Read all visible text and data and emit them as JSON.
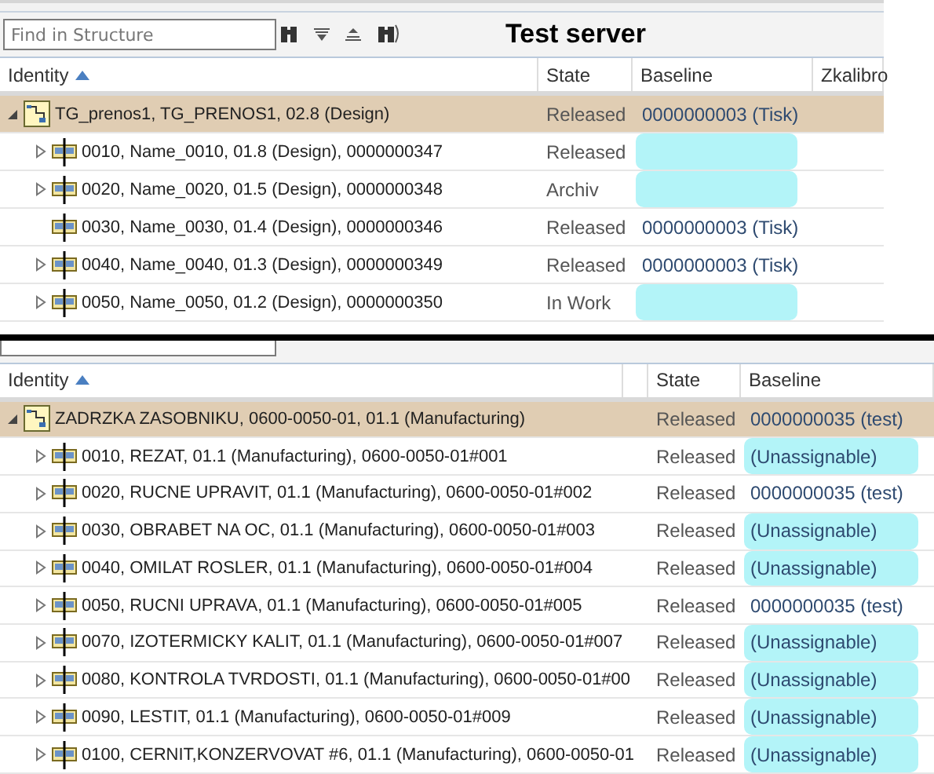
{
  "panels": [
    {
      "search": {
        "placeholder": "Find in Structure"
      },
      "title": "Test server",
      "columns": [
        {
          "label": "Identity",
          "sorted": true
        },
        {
          "label": "State"
        },
        {
          "label": "Baseline"
        },
        {
          "label": "Zkalibro"
        }
      ],
      "tree": {
        "identity": "TG_prenos1, TG_PRENOS1, 02.8 (Design)",
        "state": "Released",
        "baseline": "0000000003 (Tisk)",
        "highlighted": false,
        "expanded": true,
        "children": [
          {
            "identity": "0010, Name_0010, 01.8 (Design), 0000000347",
            "state": "Released",
            "highlighted": true,
            "expandable": true
          },
          {
            "identity": "0020, Name_0020, 01.5 (Design), 0000000348",
            "state": "Archiv",
            "highlighted": true,
            "expandable": true
          },
          {
            "identity": "0030, Name_0030, 01.4 (Design), 0000000346",
            "state": "Released",
            "baseline": "0000000003 (Tisk)",
            "highlighted": false,
            "expandable": false
          },
          {
            "identity": "0040, Name_0040, 01.3 (Design), 0000000349",
            "state": "Released",
            "baseline": "0000000003 (Tisk)",
            "highlighted": false,
            "expandable": true
          },
          {
            "identity": "0050, Name_0050, 01.2 (Design), 0000000350",
            "state": "In Work",
            "highlighted": true,
            "expandable": true
          }
        ]
      }
    },
    {
      "columns": [
        {
          "label": "Identity",
          "sorted": true
        },
        {
          "label": "State"
        },
        {
          "label": "Baseline"
        }
      ],
      "tree": {
        "identity": "ZADRZKA ZASOBNIKU, 0600-0050-01, 01.1 (Manufacturing)",
        "state": "Released",
        "baseline": "0000000035 (test)",
        "highlighted": false,
        "expanded": true,
        "children": [
          {
            "identity": "0010, REZAT, 01.1 (Manufacturing), 0600-0050-01#001",
            "state": "Released",
            "baseline": "(Unassignable)",
            "highlighted": true,
            "expandable": true
          },
          {
            "identity": "0020, RUCNE UPRAVIT, 01.1 (Manufacturing), 0600-0050-01#002",
            "state": "Released",
            "baseline": "0000000035 (test)",
            "highlighted": false,
            "expandable": true
          },
          {
            "identity": "0030, OBRABET NA OC, 01.1 (Manufacturing), 0600-0050-01#003",
            "state": "Released",
            "baseline": "(Unassignable)",
            "highlighted": true,
            "expandable": true
          },
          {
            "identity": "0040, OMILAT ROSLER, 01.1 (Manufacturing), 0600-0050-01#004",
            "state": "Released",
            "baseline": "(Unassignable)",
            "highlighted": true,
            "expandable": true
          },
          {
            "identity": "0050, RUCNI UPRAVA, 01.1 (Manufacturing), 0600-0050-01#005",
            "state": "Released",
            "baseline": "0000000035 (test)",
            "highlighted": false,
            "expandable": true
          },
          {
            "identity": "0070, IZOTERMICKY KALIT, 01.1 (Manufacturing), 0600-0050-01#007",
            "state": "Released",
            "baseline": "(Unassignable)",
            "highlighted": true,
            "expandable": true
          },
          {
            "identity": "0080, KONTROLA TVRDOSTI, 01.1 (Manufacturing), 0600-0050-01#00",
            "state": "Released",
            "baseline": "(Unassignable)",
            "highlighted": true,
            "expandable": true
          },
          {
            "identity": "0090, LESTIT, 01.1 (Manufacturing), 0600-0050-01#009",
            "state": "Released",
            "baseline": "(Unassignable)",
            "highlighted": true,
            "expandable": true
          },
          {
            "identity": "0100, CERNIT,KONZERVOVAT #6, 01.1 (Manufacturing), 0600-0050-01",
            "state": "Released",
            "baseline": "(Unassignable)",
            "highlighted": true,
            "expandable": true
          }
        ]
      }
    }
  ]
}
